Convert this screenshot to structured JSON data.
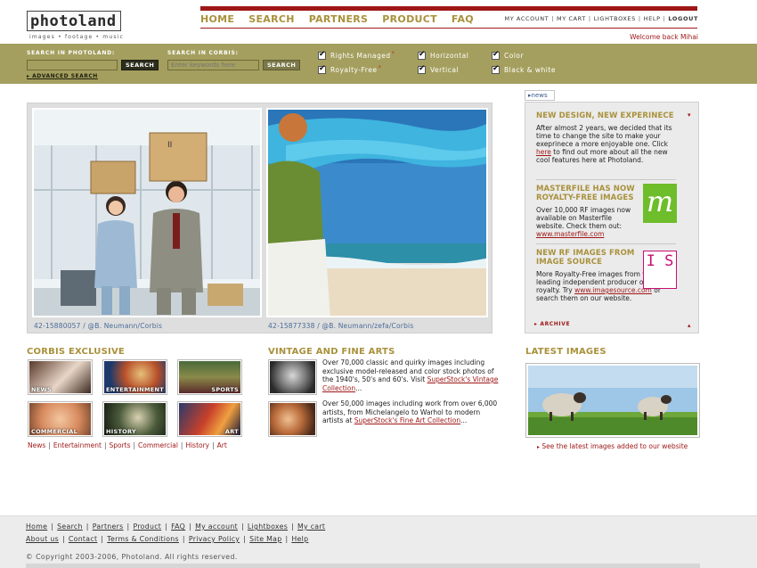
{
  "logo": {
    "word": "photoland",
    "tagline": "images • footage • music"
  },
  "nav": {
    "main": [
      "HOME",
      "SEARCH",
      "PARTNERS",
      "PRODUCT",
      "FAQ"
    ],
    "util": [
      "MY ACCOUNT",
      "MY CART",
      "LIGHTBOXES",
      "HELP",
      "LOGOUT"
    ],
    "welcome": "Welcome back Mihai"
  },
  "search": {
    "photoland_label": "SEARCH IN PHOTOLAND:",
    "photoland_value": "",
    "corbis_label": "SEARCH IN CORBIS:",
    "corbis_placeholder": "Enter keywords here",
    "button": "SEARCH",
    "advanced": "ADVANCED SEARCH",
    "filters": [
      {
        "label": "Rights Managed",
        "checked": true
      },
      {
        "label": "Royalty-Free",
        "checked": true
      },
      {
        "label": "Horizontal",
        "checked": true
      },
      {
        "label": "Vertical",
        "checked": true
      },
      {
        "label": "Color",
        "checked": true
      },
      {
        "label": "Black & white",
        "checked": true
      }
    ]
  },
  "hero": {
    "captions": [
      "42-15880057 / @B. Neumann/Corbis",
      "42-15877338 / @B. Neumann/zefa/Corbis"
    ]
  },
  "news": {
    "tab": "news",
    "items": [
      {
        "title": "NEW DESIGN, NEW EXPERINECE",
        "text_before": "After almost 2 years, we decided that its time to change the site to make your exeprinece a more enjoyable one. Click ",
        "link": "here",
        "text_after": " to find out more about all the new cool features here at Photoland."
      },
      {
        "title": "MASTERFILE HAS NOW ROYALTY-FREE IMAGES",
        "text_before": "Over 10,000 RF images now available on Masterfile website. Check them out: ",
        "link": "www.masterfile.com",
        "text_after": ""
      },
      {
        "title": "NEW RF IMAGES FROM IMAGE SOURCE",
        "text_before": "More Royalty-Free images from world's leading independent producer of creative royalty. Try ",
        "link": "www.imagesource.com",
        "text_after": " or search them on our website."
      }
    ],
    "archive": "ARCHIVE",
    "masterfile_logo": "m",
    "imagesource_logo": "I S"
  },
  "corbis": {
    "title": "CORBIS EXCLUSIVE",
    "thumbs": [
      "NEWS",
      "ENTERTAINMENT",
      "SPORTS",
      "COMMERCIAL",
      "HISTORY",
      "ART"
    ],
    "links": [
      "News",
      "Entertainment",
      "Sports",
      "Commercial",
      "History",
      "Art"
    ]
  },
  "vintage": {
    "title": "VINTAGE AND FINE ARTS",
    "items": [
      {
        "text": "Over 70,000 classic and quirky images including exclusive model-released and color stock photos of the 1940's, 50's and 60's. Visit ",
        "link": "SuperStock's Vintage Collection",
        "after": "..."
      },
      {
        "text": "Over 50,000 images including work from over 6,000 artists, from Michelangelo to Warhol to modern artists at ",
        "link": "SuperStock's Fine Art Collection",
        "after": "..."
      }
    ]
  },
  "latest": {
    "title": "LATEST IMAGES",
    "link": "See the latest images added to our website"
  },
  "footer": {
    "row1": [
      "Home",
      "Search",
      "Partners",
      "Product",
      "FAQ",
      "My account",
      "Lightboxes",
      "My cart"
    ],
    "row2": [
      "About us",
      "Contact",
      "Terms & Conditions",
      "Privacy Policy",
      "Site Map",
      "Help"
    ],
    "copyright": "© Copyright  2003-2006, Photoland. All rights reserved."
  },
  "colors": {
    "accent": "#a9913b",
    "brand_red": "#9e1616",
    "searchbar": "#a49f5e"
  }
}
